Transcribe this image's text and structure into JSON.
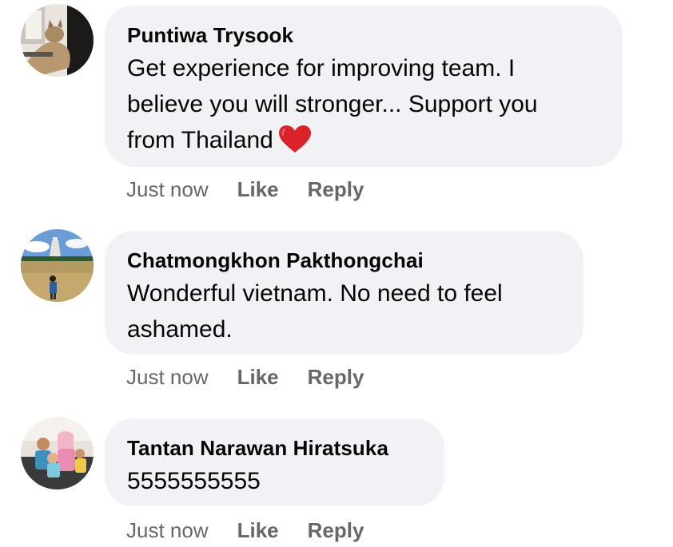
{
  "comments": [
    {
      "author": "Puntiwa Trysook",
      "text_lines": [
        "Get experience for improving team. I",
        "believe you will stronger... Support you",
        "from Thailand"
      ],
      "emoji": "heart-icon",
      "timestamp": "Just now",
      "like_label": "Like",
      "reply_label": "Reply"
    },
    {
      "author": "Chatmongkhon Pakthongchai",
      "text_lines": [
        "Wonderful vietnam. No need to feel",
        "ashamed."
      ],
      "timestamp": "Just now",
      "like_label": "Like",
      "reply_label": "Reply"
    },
    {
      "author": "Tantan Narawan Hiratsuka",
      "text_lines": [
        "5555555555"
      ],
      "timestamp": "Just now",
      "like_label": "Like",
      "reply_label": "Reply"
    }
  ],
  "colors": {
    "bubble": "#f0f2f5",
    "text": "#050505",
    "secondary": "#65676b",
    "heart": "#e0262d"
  }
}
